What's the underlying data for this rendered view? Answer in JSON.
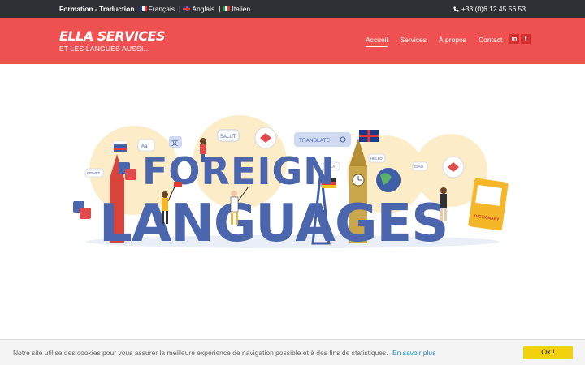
{
  "topbar": {
    "brand": "Formation - Traduction",
    "languages": [
      "Français",
      "Anglais",
      "Italien"
    ],
    "separator": "|",
    "phone": "+33 (0)6 12 45 56 53"
  },
  "header": {
    "logo_title": "ELLA SERVICES",
    "logo_subtitle": "ET LES LANGUES AUSSI...",
    "nav": [
      "Accueil",
      "Services",
      "À propos",
      "Contact"
    ],
    "active_nav": "Accueil",
    "social": [
      "in",
      "f"
    ]
  },
  "hero": {
    "line1": "FOREIGN",
    "line2": "LANGUAGES",
    "bubbles": [
      "SALUT",
      "TRANSLATE",
      "HELLO",
      "Aa",
      "文",
      "DICTIONARY",
      "PRIVET",
      "HOLA",
      "CIAO"
    ]
  },
  "cookie": {
    "message": "Notre site utilise des cookies pour vous assurer la meilleure expérience de navigation possible et à des fins de statistiques.",
    "more_label": "En savoir plus",
    "ok_label": "Ok !"
  },
  "colors": {
    "topbar_bg": "#2f2f36",
    "header_bg": "#ef5152",
    "cookie_button": "#f2d10f",
    "link": "#2b8ac6"
  }
}
